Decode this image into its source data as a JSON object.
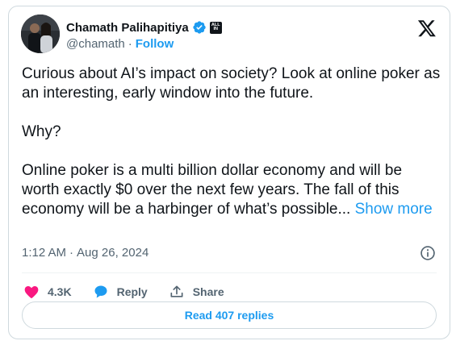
{
  "author": {
    "name": "Chamath Palihapitiya",
    "handle": "@chamath",
    "separator": "·",
    "follow_label": "Follow",
    "affiliate_badge_text": "ALL IN",
    "avatar_icon": "profile-photo"
  },
  "tweet": {
    "text": "Curious about AI’s impact on society? Look at online poker as an interesting, early window into the future.\n\nWhy?\n\nOnline poker is a multi billion dollar economy and will be worth exactly $0 over the next few years. The fall of this economy will be a harbinger of what’s possible... ",
    "show_more_label": "Show more",
    "time": "1:12 AM",
    "date_separator": "·",
    "date": "Aug 26, 2024"
  },
  "actions": {
    "like_count": "4.3K",
    "reply_label": "Reply",
    "share_label": "Share"
  },
  "replies_button_label": "Read 407 replies",
  "colors": {
    "accent": "#1d9bf0",
    "like": "#f91880",
    "text": "#0f1419",
    "secondary": "#536471",
    "border": "#cfd9de"
  }
}
